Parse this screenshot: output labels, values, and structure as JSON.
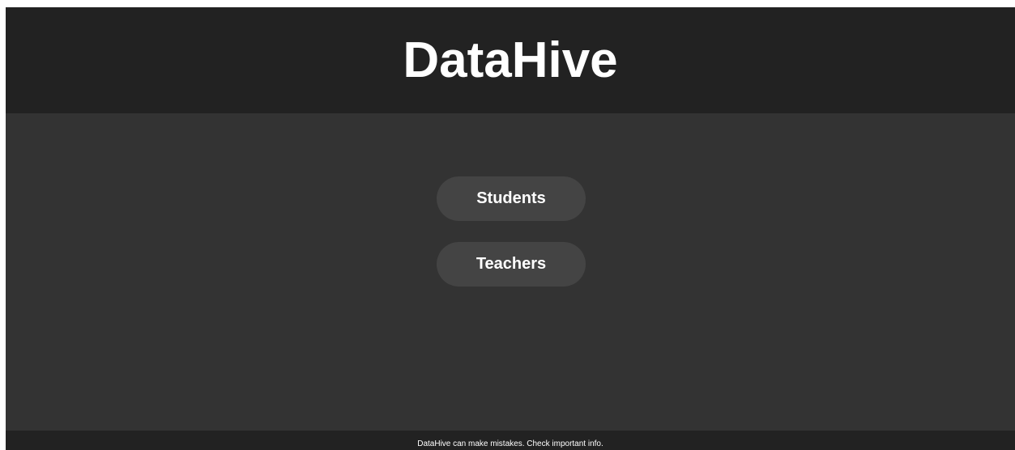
{
  "header": {
    "title": "DataHive"
  },
  "main": {
    "buttons": [
      {
        "label": "Students"
      },
      {
        "label": "Teachers"
      }
    ]
  },
  "footer": {
    "disclaimer": "DataHive can make mistakes. Check important info."
  },
  "colors": {
    "header_bg": "#222222",
    "main_bg": "#333333",
    "button_bg": "#444444",
    "text": "#ffffff"
  }
}
